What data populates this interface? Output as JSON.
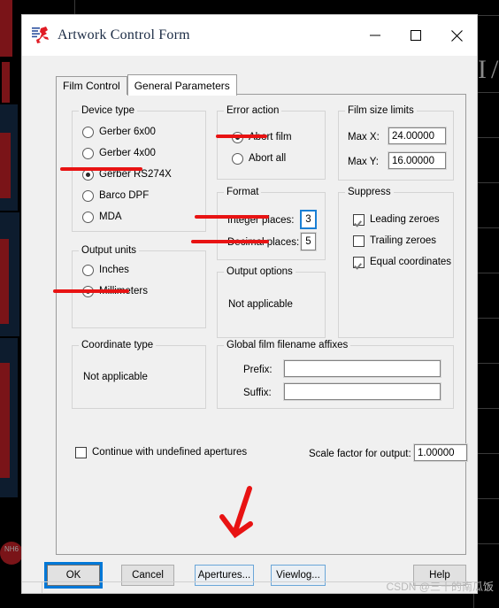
{
  "window": {
    "title": "Artwork Control Form",
    "icon": "artwork-app-icon",
    "minimize": "minimize-icon",
    "maximize": "maximize-icon",
    "close": "close-icon"
  },
  "tabs": [
    {
      "label": "Film Control",
      "active": false
    },
    {
      "label": "General Parameters",
      "active": true
    }
  ],
  "groups": {
    "device_type": {
      "legend": "Device type",
      "options": [
        {
          "label": "Gerber 6x00",
          "selected": false
        },
        {
          "label": "Gerber 4x00",
          "selected": false
        },
        {
          "label": "Gerber RS274X",
          "selected": true
        },
        {
          "label": "Barco DPF",
          "selected": false
        },
        {
          "label": "MDA",
          "selected": false
        }
      ]
    },
    "output_units": {
      "legend": "Output units",
      "options": [
        {
          "label": "Inches",
          "selected": false
        },
        {
          "label": "Millimeters",
          "selected": true
        }
      ]
    },
    "coordinate_type": {
      "legend": "Coordinate type",
      "value": "Not applicable"
    },
    "error_action": {
      "legend": "Error action",
      "options": [
        {
          "label": "Abort film",
          "selected": true
        },
        {
          "label": "Abort all",
          "selected": false
        }
      ]
    },
    "format": {
      "legend": "Format",
      "integer_places_label": "Integer places:",
      "integer_places_value": "3",
      "decimal_places_label": "Decimal places:",
      "decimal_places_value": "5"
    },
    "output_options": {
      "legend": "Output options",
      "value": "Not applicable"
    },
    "film_size_limits": {
      "legend": "Film size limits",
      "max_x_label": "Max X:",
      "max_x_value": "24.00000",
      "max_y_label": "Max Y:",
      "max_y_value": "16.00000"
    },
    "suppress": {
      "legend": "Suppress",
      "options": [
        {
          "label": "Leading zeroes",
          "checked": true
        },
        {
          "label": "Trailing zeroes",
          "checked": false
        },
        {
          "label": "Equal coordinates",
          "checked": true
        }
      ]
    },
    "affixes": {
      "legend": "Global film filename affixes",
      "prefix_label": "Prefix:",
      "prefix_value": "",
      "prefix_placeholder": "",
      "suffix_label": "Suffix:",
      "suffix_value": "",
      "suffix_placeholder": ""
    }
  },
  "footer_fields": {
    "continue_undefined_label": "Continue with undefined apertures",
    "continue_undefined_checked": false,
    "scale_factor_label": "Scale factor for output:",
    "scale_factor_value": "1.00000"
  },
  "buttons": [
    {
      "name": "ok",
      "label": "OK",
      "style": "default"
    },
    {
      "name": "cancel",
      "label": "Cancel",
      "style": "normal"
    },
    {
      "name": "apertures",
      "label": "Apertures...",
      "style": "highlight"
    },
    {
      "name": "viewlog",
      "label": "Viewlog...",
      "style": "highlight"
    },
    {
      "name": "help",
      "label": "Help",
      "style": "normal"
    }
  ],
  "annotations": {
    "arrow": "red-down-arrow pointing at Apertures... button",
    "underlines": [
      "Gerber RS274X",
      "Millimeters",
      "Abort film",
      "Integer places:",
      "Decimal places:"
    ]
  },
  "background": {
    "app": "pcb-cad-canvas",
    "label": "NH6"
  },
  "watermark": "CSDN @三十的南瓜饭",
  "colors": {
    "dialog_face": "#f0f0f0",
    "titlebar": "#ffffff",
    "accent_focus": "#0078d7",
    "annotation_red": "#e81313",
    "group_border": "#d4d4d4",
    "canvas_bg": "#000000"
  }
}
